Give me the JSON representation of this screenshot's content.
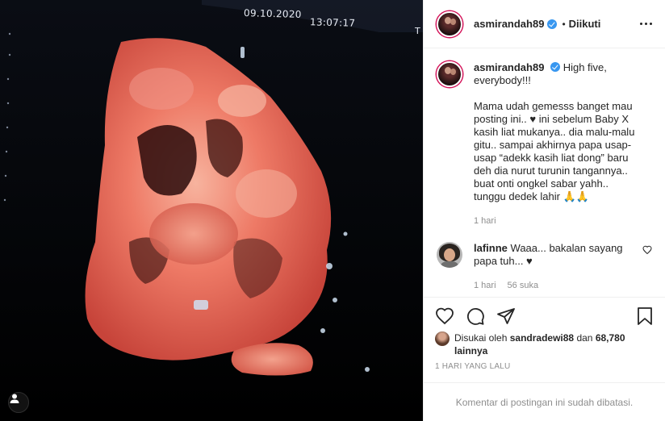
{
  "media": {
    "overlay_date": "09.10.2020",
    "overlay_time": "13:07:17",
    "overlay_edge": "T",
    "tag_icon": "user-icon"
  },
  "post": {
    "username": "asmirandah89",
    "follow_state": "Diikuti",
    "separator": "•",
    "more_icon": "more-options-icon"
  },
  "caption": {
    "username": "asmirandah89",
    "text": "High five, everybody!!!\n\nMama udah gemesss banget mau posting ini.. ♥ ini sebelum Baby X kasih liat mukanya.. dia malu-malu gitu.. sampai akhirnya papa usap-usap “adekk kasih liat dong” baru deh dia nurut turunin tangannya.. buat onti ongkel sabar yahh.. tunggu dedek lahir 🙏🙏",
    "time": "1 hari"
  },
  "comment": {
    "username": "lafinne",
    "text": "Waaa... bakalan sayang papa tuh... ♥",
    "time": "1 hari",
    "likes": "56 suka"
  },
  "actions": {
    "liked_prefix": "Disukai oleh",
    "liked_by": "sandradewi88",
    "conj": "dan",
    "others": "68,780 lainnya",
    "posted_ago": "1 HARI YANG LALU"
  },
  "footer": {
    "comments_disabled": "Komentar di postingan ini sudah dibatasi."
  },
  "colors": {
    "verified": "#3897f0",
    "story_ring": "#d4145a",
    "muted": "#8e8e8e"
  }
}
